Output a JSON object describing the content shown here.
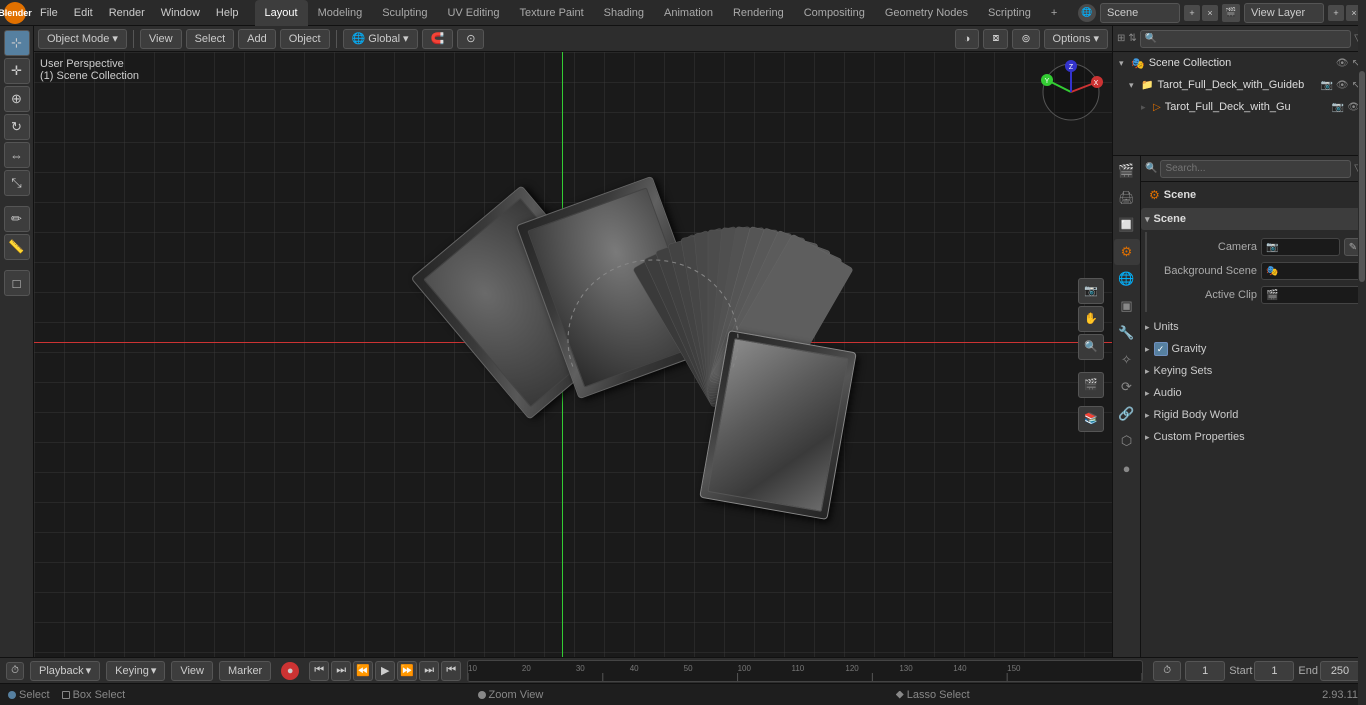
{
  "app": {
    "title": "Blender"
  },
  "top_menu": {
    "logo": "B",
    "items": [
      "File",
      "Edit",
      "Render",
      "Window",
      "Help"
    ],
    "workspace_tabs": [
      "Layout",
      "Modeling",
      "Sculpting",
      "UV Editing",
      "Texture Paint",
      "Shading",
      "Animation",
      "Rendering",
      "Compositing",
      "Geometry Nodes",
      "Scripting"
    ],
    "active_tab": "Layout",
    "plus_label": "+",
    "scene_label": "Scene",
    "view_layer_label": "View Layer"
  },
  "viewport": {
    "mode_label": "Object Mode",
    "view_label": "View",
    "select_label": "Select",
    "add_label": "Add",
    "object_label": "Object",
    "perspective_label": "User Perspective",
    "collection_label": "(1) Scene Collection",
    "global_label": "Global",
    "options_label": "Options"
  },
  "outliner": {
    "title": "Scene Collection",
    "items": [
      {
        "name": "Scene Collection",
        "icon": "📁",
        "level": 0,
        "expanded": true
      },
      {
        "name": "Tarot_Full_Deck_with_Guideb",
        "icon": "📦",
        "level": 1,
        "expanded": true
      },
      {
        "name": "Tarot_Full_Deck_with_Gu",
        "icon": "🎬",
        "level": 2,
        "expanded": false
      }
    ]
  },
  "properties": {
    "scene_name": "Scene",
    "sections": {
      "scene_header": "Scene",
      "scene_section": {
        "header": "Scene",
        "camera_label": "Camera",
        "camera_value": "",
        "background_scene_label": "Background Scene",
        "active_clip_label": "Active Clip",
        "active_clip_value": ""
      },
      "units_label": "Units",
      "gravity_label": "Gravity",
      "gravity_enabled": true,
      "keying_sets_label": "Keying Sets",
      "audio_label": "Audio",
      "rigid_body_world_label": "Rigid Body World",
      "custom_properties_label": "Custom Properties"
    }
  },
  "timeline": {
    "playback_label": "Playback",
    "keying_label": "Keying",
    "view_label": "View",
    "marker_label": "Marker",
    "frame_current": "1",
    "frame_start_label": "Start",
    "frame_start": "1",
    "frame_end_label": "End",
    "frame_end": "250",
    "controls": [
      "⏮",
      "⏭",
      "⏪",
      "▶",
      "⏩",
      "⏮",
      "⏭"
    ]
  },
  "status_bar": {
    "select_label": "Select",
    "box_select_label": "Box Select",
    "zoom_view_label": "Zoom View",
    "lasso_select_label": "Lasso Select",
    "version_label": "2.93.11"
  },
  "props_sidebar_icons": [
    "🔧",
    "🔩",
    "📷",
    "🌈",
    "🎨",
    "⚡",
    "🌐",
    "🔵"
  ],
  "colors": {
    "accent": "#5680a0",
    "orange": "#e07000",
    "bg_dark": "#1e1e1e",
    "bg_mid": "#2d2d2d",
    "bg_light": "#3d3d3d",
    "border": "#555",
    "text": "#cccccc",
    "text_dim": "#888888"
  }
}
